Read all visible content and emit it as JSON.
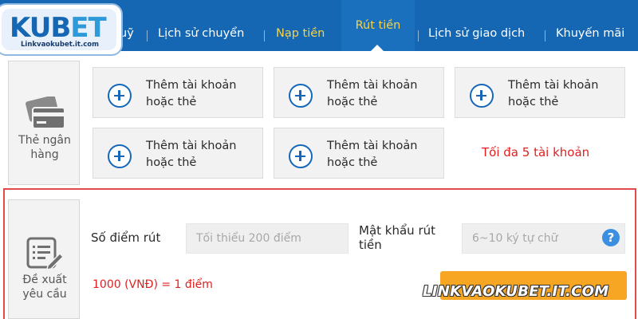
{
  "logo": {
    "title_main": "KUB",
    "title_accent": "ET",
    "subtitle": "Linkvaokubet.it.com"
  },
  "nav": {
    "partial_item": "uỹ",
    "transfer_history": "Lịch sử chuyển",
    "deposit": "Nạp tiền",
    "withdraw": "Rút tiền",
    "transaction_history": "Lịch sử giao dịch",
    "promotions": "Khuyến mãi",
    "accent_color": "#f6d34a",
    "bar_color": "#1567b3"
  },
  "bank": {
    "label_line1": "Thẻ ngân",
    "label_line2": "hàng",
    "icon": "bank-card-icon",
    "cards": [
      {
        "line1": "Thêm tài khoản",
        "line2": "hoặc thẻ"
      },
      {
        "line1": "Thêm tài khoản",
        "line2": "hoặc thẻ"
      },
      {
        "line1": "Thêm tài khoản",
        "line2": "hoặc thẻ"
      },
      {
        "line1": "Thêm tài khoản",
        "line2": "hoặc thẻ"
      },
      {
        "line1": "Thêm tài khoản",
        "line2": "hoặc thẻ"
      }
    ],
    "max_note": "Tối đa 5 tài khoản"
  },
  "request": {
    "label_line1": "Đề xuất",
    "label_line2": "yêu cầu",
    "icon": "request-form-icon",
    "points_label": "Số điểm rút",
    "points_placeholder": "Tối thiểu 200 điểm",
    "password_label_line1": "Mật khẩu rút",
    "password_label_line2": "tiền",
    "password_placeholder": "6~10 ký tự chữ",
    "help_glyph": "?",
    "rate_text": "1000 (VNĐ) = 1 điểm",
    "submit_color": "#f6a623",
    "highlight_color": "#e04a4a"
  },
  "watermark": "LINKVAOKUBET.IT.COM"
}
